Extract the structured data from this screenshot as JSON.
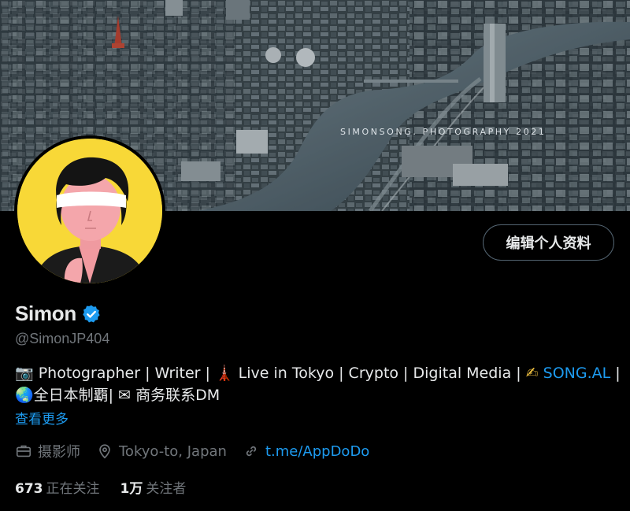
{
  "banner": {
    "caption": "SIMONSONG. PHOTOGRAPHY 2021",
    "description_icon": "city-river-aerial-photo"
  },
  "profile": {
    "name": "Simon",
    "handle": "@SimonJP404",
    "verified_icon": "verified-badge-icon",
    "edit_button": "编辑个人资料"
  },
  "bio": {
    "line1_camera": "📷",
    "line1_text": " Photographer | Writer | ",
    "tower_emoji": "🗼",
    "line1_text2": " Live in Tokyo | Crypto | Digital Media | ",
    "writing_emoji": "✍",
    "link_text": " SONG.AL",
    "line1_end": " |",
    "globe_emoji": "🌏",
    "line2_text": "全日本制覇| ",
    "mail_emoji": "✉",
    "line2_text2": " 商务联系DM",
    "more_label": "查看更多"
  },
  "meta": {
    "job_icon": "briefcase-icon",
    "job": "摄影师",
    "location_icon": "location-pin-icon",
    "location": "Tokyo-to, Japan",
    "link_icon": "link-icon",
    "link": "t.me/AppDoDo"
  },
  "stats": {
    "following_count": "673",
    "following_label": "正在关注",
    "followers_count": "1万",
    "followers_label": "关注者"
  },
  "colors": {
    "accent": "#1d9bf0",
    "background": "#000000",
    "secondary_text": "#71767b",
    "avatar_bg": "#f8d837"
  }
}
